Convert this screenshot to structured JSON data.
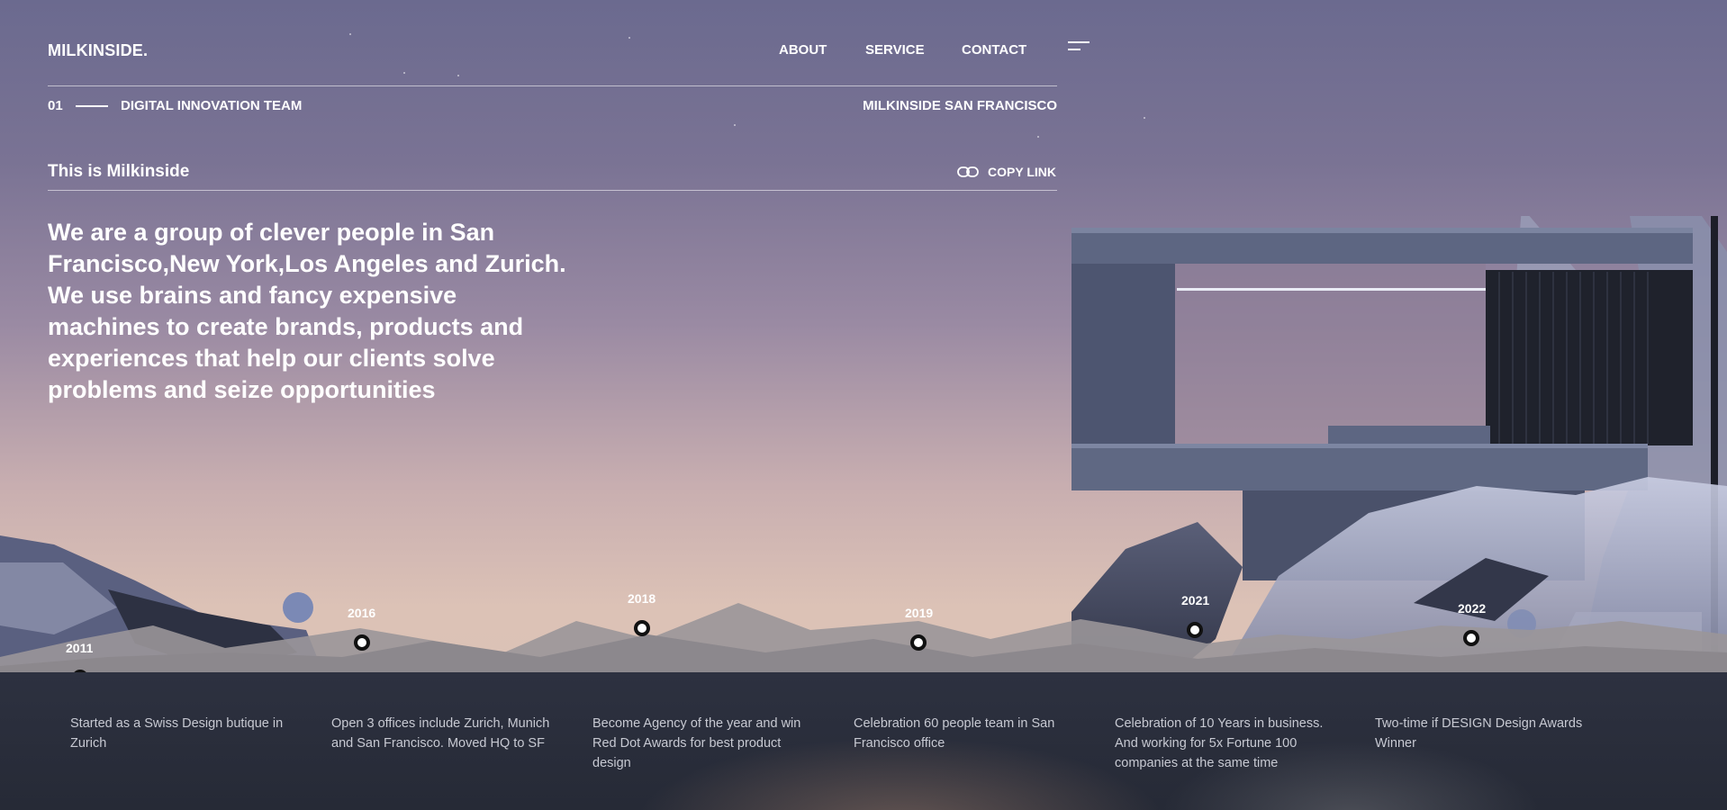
{
  "brand": {
    "logo": "MILKINSIDE."
  },
  "nav": {
    "items": [
      "ABOUT",
      "SERVICE",
      "CONTACT"
    ]
  },
  "subheader": {
    "index": "01",
    "team": "DIGITAL INNOVATION TEAM",
    "location": "MILKINSIDE SAN FRANCISCO"
  },
  "section": {
    "title": "This is Milkinside",
    "copy_link": "COPY LINK",
    "headline": "We are a group of clever people in San Francisco,New York,Los Angeles and Zurich. We use brains and fancy expensive machines to create brands, products and experiences that help our clients solve problems and seize opportunities"
  },
  "timeline": {
    "years": [
      "2011",
      "2016",
      "2018",
      "2019",
      "2021",
      "2022"
    ],
    "descriptions": [
      "Started as a Swiss Design butique in Zurich",
      "Open 3 offices include Zurich, Munich and San Francisco. Moved HQ to SF",
      "Become Agency of the year and win Red Dot Awards for best product design",
      "Celebration 60 people team in San Francisco office",
      "Celebration of 10 Years in business. And working for 5x Fortune 100 companies at the same time",
      "Two-time if DESIGN Design Awards Winner"
    ]
  },
  "icons": {
    "menu": "menu-icon",
    "link": "link-icon"
  },
  "colors": {
    "sky_top": "#6b6a8f",
    "sky_bottom": "#dcc2b6",
    "panel": "#262a36",
    "text_muted": "#c7c9d2"
  }
}
